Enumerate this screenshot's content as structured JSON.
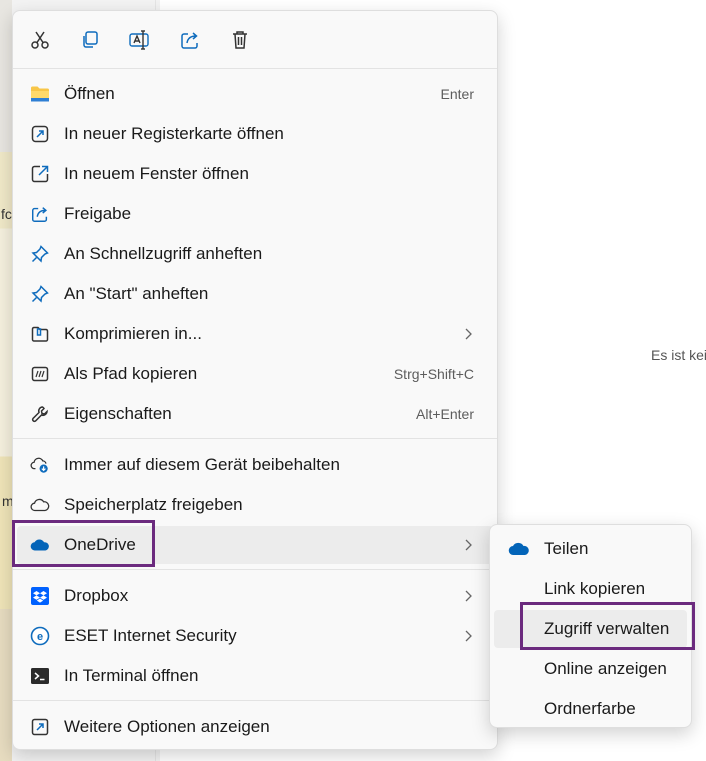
{
  "background": {
    "left_fragments": [
      "fc",
      "m"
    ],
    "right_text": "Es ist kei"
  },
  "toolbar": {
    "cut_icon": "scissors-icon",
    "copy_icon": "copy-icon",
    "rename_icon": "rename-icon",
    "share_icon": "share-icon",
    "delete_icon": "trash-icon"
  },
  "menu": {
    "items": [
      {
        "label": "Öffnen",
        "shortcut": "Enter",
        "icon": "folder-icon"
      },
      {
        "label": "In neuer Registerkarte öffnen",
        "icon": "new-tab-icon"
      },
      {
        "label": "In neuem Fenster öffnen",
        "icon": "new-window-icon"
      },
      {
        "label": "Freigabe",
        "icon": "share-icon"
      },
      {
        "label": "An Schnellzugriff anheften",
        "icon": "pin-icon"
      },
      {
        "label": "An \"Start\" anheften",
        "icon": "pin-icon"
      },
      {
        "label": "Komprimieren in...",
        "icon": "zip-icon"
      },
      {
        "label": "Als Pfad kopieren",
        "shortcut": "Strg+Shift+C",
        "icon": "path-icon"
      },
      {
        "label": "Eigenschaften",
        "shortcut": "Alt+Enter",
        "icon": "wrench-icon"
      },
      {
        "label": "Immer auf diesem Gerät beibehalten",
        "icon": "cloud-download-icon"
      },
      {
        "label": "Speicherplatz freigeben",
        "icon": "cloud-outline-icon"
      },
      {
        "label": "OneDrive",
        "icon": "onedrive-icon"
      },
      {
        "label": "Dropbox",
        "icon": "dropbox-icon"
      },
      {
        "label": "ESET Internet Security",
        "icon": "eset-icon"
      },
      {
        "label": "In Terminal öffnen",
        "icon": "terminal-icon"
      },
      {
        "label": "Weitere Optionen anzeigen",
        "icon": "more-options-icon"
      }
    ]
  },
  "submenu": {
    "items": [
      {
        "label": "Teilen",
        "icon": "onedrive-icon"
      },
      {
        "label": "Link kopieren"
      },
      {
        "label": "Zugriff verwalten"
      },
      {
        "label": "Online anzeigen"
      },
      {
        "label": "Ordnerfarbe"
      }
    ]
  },
  "colors": {
    "accent_blue": "#0f6cbd",
    "onedrive_blue": "#0364b8",
    "dropbox_blue": "#0061fe",
    "highlight_purple": "#6b2a7e",
    "folder_yellow": "#f8c648"
  }
}
